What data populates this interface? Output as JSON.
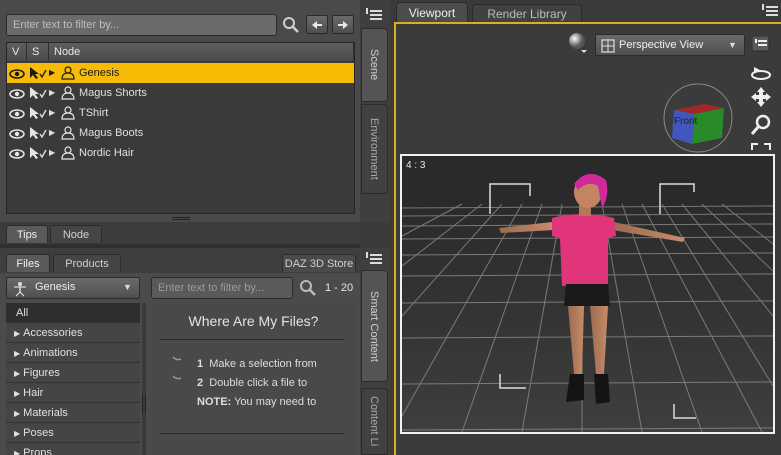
{
  "scene": {
    "filter_placeholder": "Enter text to filter by...",
    "columns": {
      "v": "V",
      "s": "S",
      "node": "Node"
    },
    "nodes": [
      {
        "label": "Genesis",
        "selected": true
      },
      {
        "label": "Magus Shorts",
        "selected": false
      },
      {
        "label": "TShirt",
        "selected": false
      },
      {
        "label": "Magus Boots",
        "selected": false
      },
      {
        "label": "Nordic Hair",
        "selected": false
      }
    ],
    "side_tabs": {
      "scene": "Scene",
      "environment": "Environment"
    }
  },
  "tips_tabs": {
    "tips": "Tips",
    "node": "Node"
  },
  "content": {
    "tabs": {
      "files": "Files",
      "products": "Products",
      "store": "DAZ 3D Store"
    },
    "figure_select": "Genesis",
    "filter_placeholder": "Enter text to filter by...",
    "page_range": "1 - 20",
    "categories": [
      "All",
      "Accessories",
      "Animations",
      "Figures",
      "Hair",
      "Materials",
      "Poses",
      "Props"
    ],
    "help_title": "Where Are My Files?",
    "help_steps": [
      "Make a selection from",
      "Double click a file to"
    ],
    "help_note_label": "NOTE:",
    "help_note_text": " You may need to",
    "side_tabs": {
      "smart": "Smart Content",
      "content": "Content Li"
    }
  },
  "viewport": {
    "tabs": {
      "viewport": "Viewport",
      "render": "Render Library"
    },
    "camera": "Perspective View",
    "cube_face": "Front",
    "aspect": "4 : 3"
  },
  "colors": {
    "selection": "#f7bb06",
    "viewport_border": "#d8b020",
    "shirt": "#e0357a"
  }
}
